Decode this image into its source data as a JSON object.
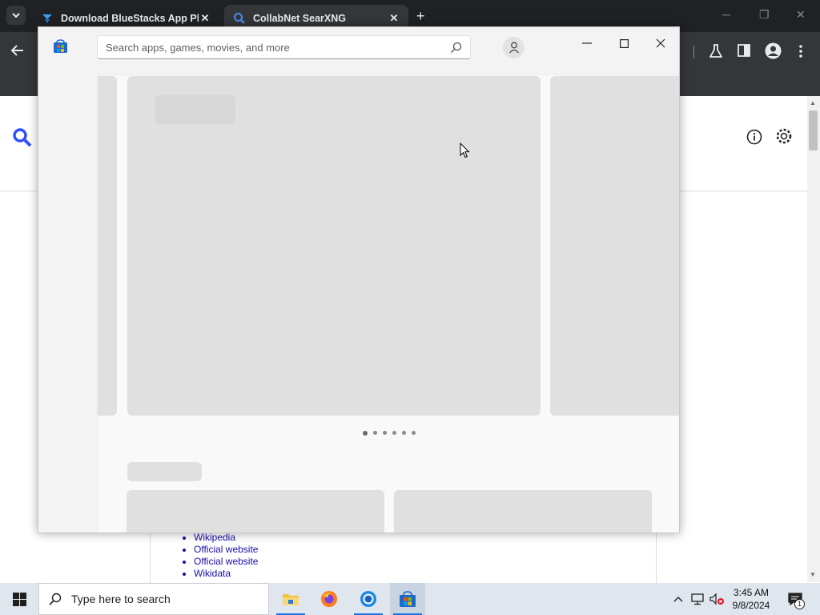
{
  "browser": {
    "tabs": [
      {
        "title": "Download BlueStacks App Play"
      },
      {
        "title": "CollabNet SearXNG"
      }
    ],
    "new_tab_symbol": "+"
  },
  "background_page": {
    "links": [
      "Wikipedia",
      "Official website",
      "Official website",
      "Wikidata"
    ]
  },
  "store": {
    "search_placeholder": "Search apps, games, movies, and more",
    "carousel_dots": 6,
    "active_dot": 0
  },
  "taskbar": {
    "search_placeholder": "Type here to search",
    "time": "3:45 AM",
    "date": "9/8/2024",
    "notification_count": "1"
  },
  "colors": {
    "chrome_dark": "#202124",
    "chrome_toolbar": "#35363a",
    "link_blue": "#1a0dab",
    "store_bg": "#f3f3f3",
    "skeleton": "#e0e0e0",
    "taskbar": "#dfe6ee"
  }
}
